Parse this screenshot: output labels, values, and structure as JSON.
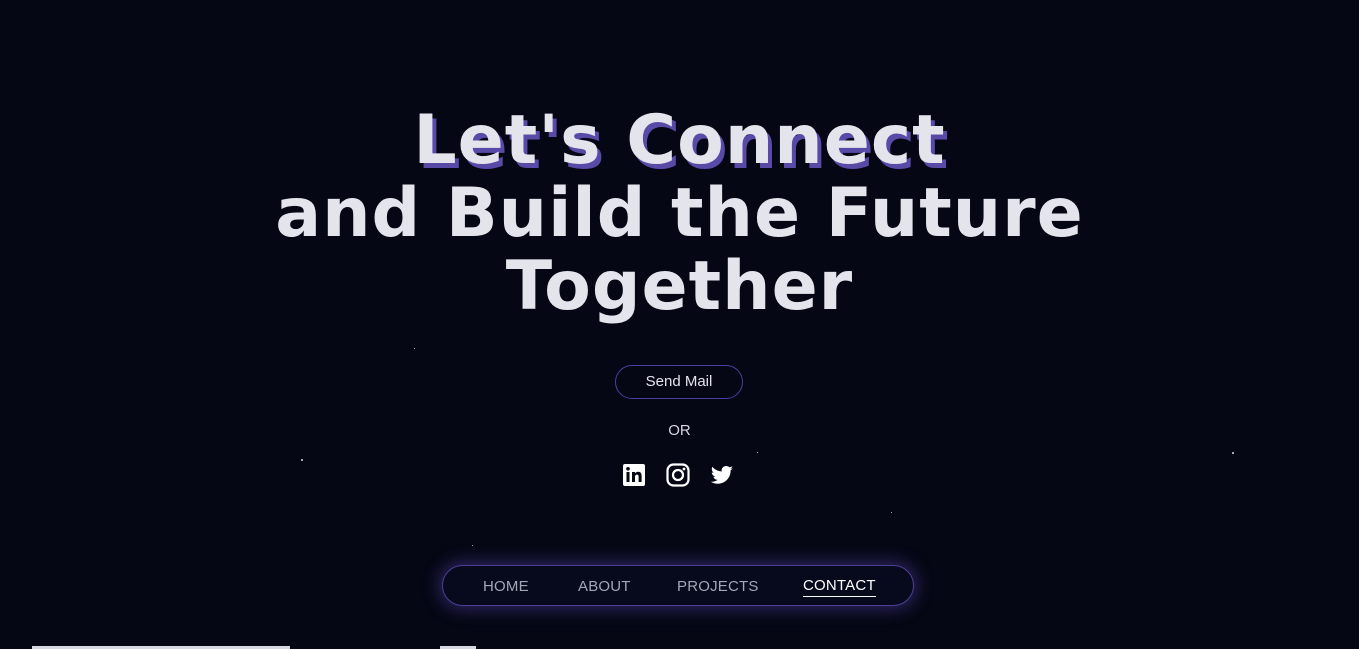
{
  "hero": {
    "line1": "Let's Connect",
    "line2": "and Build the Future",
    "line3": "Together"
  },
  "cta": {
    "send_mail_label": "Send Mail",
    "or_label": "OR"
  },
  "socials": [
    {
      "icon": "linkedin-icon"
    },
    {
      "icon": "instagram-icon"
    },
    {
      "icon": "twitter-icon"
    }
  ],
  "nav": {
    "items": [
      {
        "label": "HOME"
      },
      {
        "label": "ABOUT"
      },
      {
        "label": "PROJECTS"
      },
      {
        "label": "CONTACT",
        "active": true
      }
    ]
  },
  "colors": {
    "background": "#050714",
    "heading": "#e4e4ec",
    "accent_shadow": "#5a4aa8",
    "border": "#4b3fa0",
    "glow": "#6a54d6"
  }
}
